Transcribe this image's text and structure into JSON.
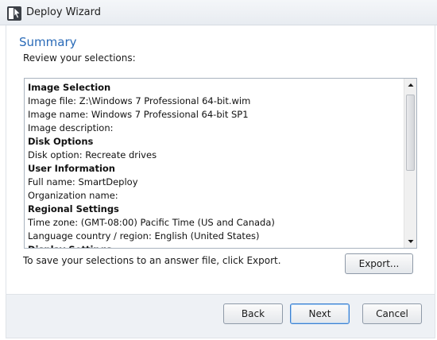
{
  "window": {
    "title": "Deploy Wizard",
    "icon": "deploy-wizard-app-icon"
  },
  "page": {
    "heading": "Summary",
    "subheading": "Review your selections:"
  },
  "summary": {
    "lines": [
      {
        "text": "Image Selection",
        "bold": true
      },
      {
        "text": "Image file: Z:\\Windows 7 Professional 64-bit.wim",
        "bold": false
      },
      {
        "text": "Image name: Windows 7 Professional 64-bit SP1",
        "bold": false
      },
      {
        "text": "Image description:",
        "bold": false
      },
      {
        "text": "Disk Options",
        "bold": true
      },
      {
        "text": "Disk option: Recreate drives",
        "bold": false
      },
      {
        "text": "User Information",
        "bold": true
      },
      {
        "text": "Full name: SmartDeploy",
        "bold": false
      },
      {
        "text": "Organization name:",
        "bold": false
      },
      {
        "text": "Regional Settings",
        "bold": true
      },
      {
        "text": "Time zone: (GMT-08:00) Pacific Time (US and Canada)",
        "bold": false
      },
      {
        "text": "Language country / region: English (United States)",
        "bold": false
      },
      {
        "text": "Display Settings",
        "bold": true
      }
    ],
    "scrollbar": {
      "up_icon": "scroll-up-arrow-icon",
      "down_icon": "scroll-down-arrow-icon"
    }
  },
  "export": {
    "hint": "To save your selections to an answer file, click Export.",
    "button_label": "Export..."
  },
  "footer": {
    "back_label": "Back",
    "next_label": "Next",
    "cancel_label": "Cancel"
  },
  "colors": {
    "heading": "#2a6bb8",
    "default_button_border": "#3c7fd0",
    "footer_background": "#eef1f5"
  }
}
